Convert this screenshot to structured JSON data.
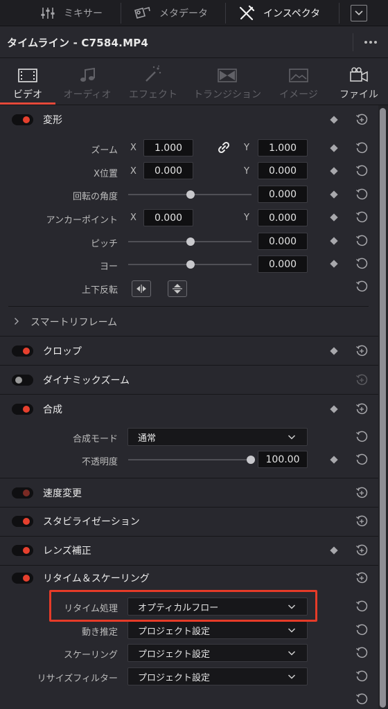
{
  "topbar": {
    "mixer_label": "ミキサー",
    "metadata_label": "メタデータ",
    "inspector_label": "インスペクタ"
  },
  "title": {
    "text": "タイムライン - C7584.MP4"
  },
  "tabs": [
    {
      "label": "ビデオ",
      "icon": "film-icon",
      "state": "active"
    },
    {
      "label": "オーディオ",
      "icon": "music-note-icon",
      "state": "disabled"
    },
    {
      "label": "エフェクト",
      "icon": "magic-wand-icon",
      "state": "disabled"
    },
    {
      "label": "トランジション",
      "icon": "transition-icon",
      "state": "disabled"
    },
    {
      "label": "イメージ",
      "icon": "image-icon",
      "state": "disabled"
    },
    {
      "label": "ファイル",
      "icon": "file-icon",
      "state": "enabled"
    }
  ],
  "transform": {
    "title": "変形",
    "zoom_label": "ズーム",
    "zoom_x": "1.000",
    "zoom_y": "1.000",
    "position_label": "X位置",
    "position_x": "0.000",
    "position_y": "0.000",
    "rotation_label": "回転の角度",
    "rotation": "0.000",
    "anchor_label": "アンカーポイント",
    "anchor_x": "0.000",
    "anchor_y": "0.000",
    "pitch_label": "ピッチ",
    "pitch": "0.000",
    "yaw_label": "ヨー",
    "yaw": "0.000",
    "flip_label": "上下反転",
    "axis_x": "X",
    "axis_y": "Y"
  },
  "smart_reframe": {
    "title": "スマートリフレーム"
  },
  "crop": {
    "title": "クロップ"
  },
  "dynamic_zoom": {
    "title": "ダイナミックズーム"
  },
  "composite": {
    "title": "合成",
    "mode_label": "合成モード",
    "mode_value": "通常",
    "opacity_label": "不透明度",
    "opacity": "100.00"
  },
  "speed_change": {
    "title": "速度変更"
  },
  "stabilization": {
    "title": "スタビライゼーション"
  },
  "lens_correction": {
    "title": "レンズ補正"
  },
  "retime": {
    "title": "リタイム＆スケーリング",
    "process_label": "リタイム処理",
    "process_value": "オプティカルフロー",
    "motion_label": "動き推定",
    "motion_value": "プロジェクト設定",
    "scaling_label": "スケーリング",
    "scaling_value": "プロジェクト設定",
    "resize_label": "リサイズフィルター",
    "resize_value": "プロジェクト設定"
  },
  "colors": {
    "accent": "#e5493a",
    "highlight": "#e63b28",
    "background": "#28282e"
  }
}
